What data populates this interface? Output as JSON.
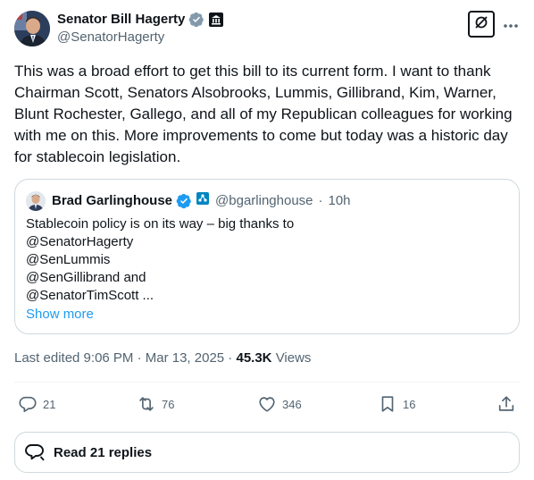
{
  "author": {
    "name": "Senator Bill Hagerty",
    "handle": "@SenatorHagerty"
  },
  "tweet": {
    "text": "This was a broad effort to get this bill to its current form. I want to thank Chairman Scott, Senators Alsobrooks, Lummis, Gillibrand, Kim, Warner, Blunt Rochester, Gallego, and all of my Republican colleagues for working with me on this. More improvements to come but today was a historic day for stablecoin legislation."
  },
  "quote": {
    "name": "Brad Garlinghouse",
    "handle": "@bgarlinghouse",
    "separator": "·",
    "time": "10h",
    "lines": [
      "Stablecoin policy is on its way – big thanks to",
      "@SenatorHagerty",
      "@SenLummis",
      "@SenGillibrand and",
      "@SenatorTimScott ..."
    ],
    "show_more": "Show more"
  },
  "meta": {
    "edited": "Last edited 9:06 PM · Mar 13, 2025 ·",
    "views_count": "45.3K",
    "views_label": "Views"
  },
  "actions": {
    "replies": "21",
    "reposts": "76",
    "likes": "346",
    "bookmarks": "16"
  },
  "read_replies": "Read 21 replies",
  "colors": {
    "text": "#0f1419",
    "secondary": "#536471",
    "link": "#1d9bf0",
    "border": "#cfd9de",
    "verified_gray": "#829aab",
    "verified_blue": "#1d9bf0"
  }
}
